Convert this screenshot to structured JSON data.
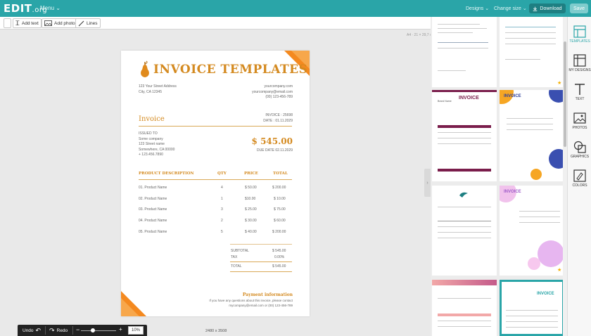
{
  "app": {
    "logo_main": "EDIT",
    "logo_suffix": ".org",
    "menu_label": "Menu",
    "designs_label": "Designs",
    "change_size_label": "Change size",
    "download_label": "Download",
    "save_label": "Save"
  },
  "toolbar": {
    "add_text": "Add text",
    "add_photo": "Add photo",
    "lines": "Lines"
  },
  "canvas": {
    "ruler_text": "A4 · 21 × 29,7 cm",
    "dimensions": "2480 x 3508"
  },
  "invoice": {
    "title": "INVOICE TEMPLATES",
    "street": "123 Your Street Address",
    "city": "City, CA 12345",
    "website": "yourcompany.com",
    "email": "yourcompany@email.com",
    "phone": "(00) 123-456-789",
    "heading": "Invoice",
    "invoice_no": "INVOICE : 25698",
    "date": "DATE : 01.11.2029",
    "issued_to": "ISSUED TO",
    "client_name": "Some company",
    "client_street": "123 Street name",
    "client_city": "Somewhere, CA 00000",
    "client_phone": "+ 123.456.7890",
    "amount": "$ 545.00",
    "due_date": "DUE DATE  02.11.2029",
    "columns": [
      "PRODUCT DESCRIPTION",
      "QTY",
      "PRICE",
      "TOTAL"
    ],
    "rows": [
      {
        "name": "01. Product Name",
        "qty": "4",
        "price": "$ 50.00",
        "total": "$ 200.00"
      },
      {
        "name": "02. Product Name",
        "qty": "1",
        "price": "$10.00",
        "total": "$ 10.00"
      },
      {
        "name": "03. Product Name",
        "qty": "3",
        "price": "$ 25.00",
        "total": "$ 75.00"
      },
      {
        "name": "04. Product Name",
        "qty": "2",
        "price": "$ 30.00",
        "total": "$ 60.00"
      },
      {
        "name": "05. Product Name",
        "qty": "5",
        "price": "$ 40.00",
        "total": "$ 200.00"
      }
    ],
    "subtotal_label": "SUBTOTAL",
    "subtotal": "$ 545.00",
    "tax_label": "TAX",
    "tax": "0.00%",
    "total_label": "TOTAL",
    "total": "$ 545.00",
    "payment_heading": "Payment information",
    "payment_line1": "If you have any questions about this invoice, please contact",
    "payment_line2": "mycompany@email.com  or  (00) 123-456-789"
  },
  "bottom": {
    "undo": "Undo",
    "redo": "Redo",
    "zoom": "10%",
    "minus": "−",
    "plus": "+"
  },
  "thumbnails": {
    "t3_title": "INVOICE",
    "t3_brand": "Brand Name",
    "t4_title": "INVOICE",
    "t6_title": "INVOICE",
    "t8_title": "INVOICE"
  },
  "sidebar": {
    "items": [
      "TEMPLATES",
      "MY DESIGNS",
      "TEXT",
      "PHOTOS",
      "GRAPHICS",
      "COLORS"
    ]
  },
  "colors": {
    "brand": "#2aa5a8",
    "accent": "#f4891f",
    "gold": "#d48a20"
  }
}
